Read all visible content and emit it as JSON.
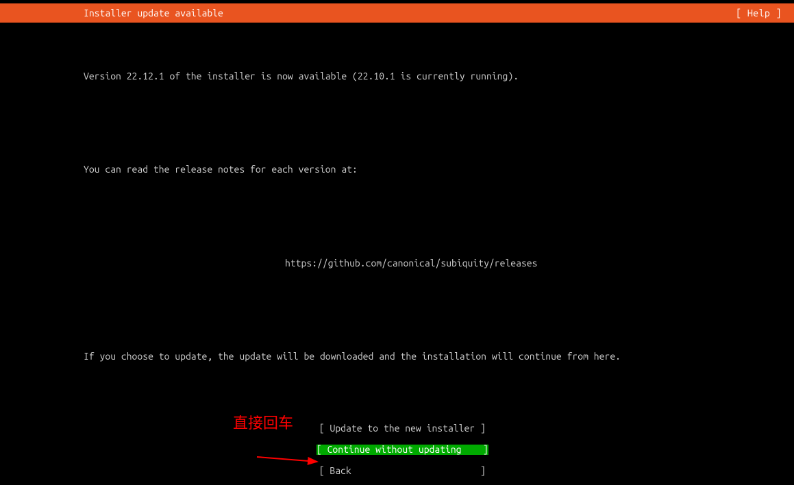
{
  "titlebar": {
    "title": "Installer update available",
    "help": "[ Help ]"
  },
  "content": {
    "line1": "Version 22.12.1 of the installer is now available (22.10.1 is currently running).",
    "line2": "You can read the release notes for each version at:",
    "url": "https://github.com/canonical/subiquity/releases",
    "line3": "If you choose to update, the update will be downloaded and the installation will continue from here."
  },
  "buttons": {
    "update": "[ Update to the new installer ]",
    "continue": "[ Continue without updating    ]",
    "back": "[ Back                        ]"
  },
  "annotation": {
    "text": "直接回车"
  }
}
